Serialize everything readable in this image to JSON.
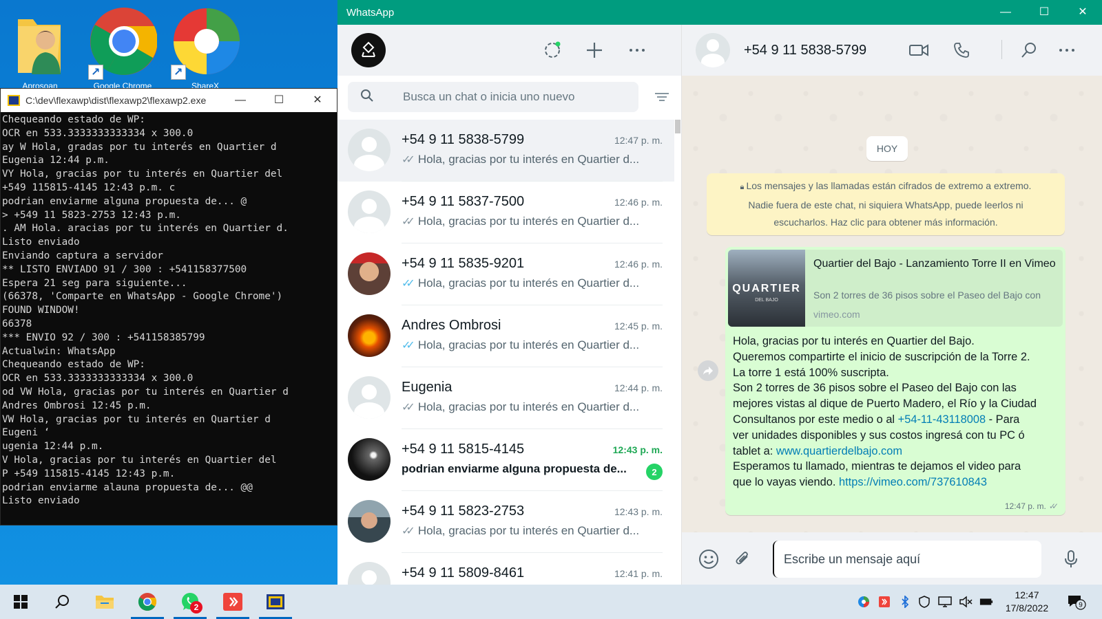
{
  "desktop": {
    "icons": [
      {
        "label": "Aprosoan"
      },
      {
        "label": "Google Chrome"
      },
      {
        "label": "ShareX"
      }
    ]
  },
  "console": {
    "title": "C:\\dev\\flexawp\\dist\\flexawp2\\flexawp2.exe",
    "controls": {
      "minimize": "—",
      "maximize": "☐",
      "close": "✕"
    },
    "lines": [
      "Chequeando estado de WP:",
      "OCR en 533.3333333333334 x 300.0",
      "ay W Hola, gradas por tu interés en Quartier d",
      "Eugenia 12:44 p.m.",
      "VY Hola, gracias por tu interés en Quartier del",
      "+549 115815-4145 12:43 p.m. c",
      "podrian enviarme alguna propuesta de... @",
      "> +549 11 5823-2753 12:43 p.m.",
      ". AM Hola. aracias por tu interés en Quartier d.",
      "Listo enviado",
      "Enviando captura a servidor",
      "** LISTO ENVIADO 91 / 300 : +541158377500",
      "Espera 21 seg para siguiente...",
      "(66378, 'Comparte en WhatsApp - Google Chrome')",
      "FOUND WINDOW!",
      "66378",
      "*** ENVIO 92 / 300 : +541158385799",
      "Actualwin: WhatsApp",
      "Chequeando estado de WP:",
      "OCR en 533.3333333333334 x 300.0",
      "od VW Hola, gracias por tu interés en Quartier d",
      "Andres Ombrosi 12:45 p.m.",
      "VW Hola, gracias por tu interés en Quartier d",
      "Eugeni ‘",
      "ugenia 12:44 p.m.",
      "V Hola, gracias por tu interés en Quartier del",
      "P +549 115815-4145 12:43 p.m.",
      "podrian enviarme alauna propuesta de... @@",
      "Listo enviado"
    ]
  },
  "whatsapp": {
    "window_title": "WhatsApp",
    "window_controls": {
      "minimize": "—",
      "maximize": "☐",
      "close": "✕"
    },
    "accent": "#009c7f",
    "search_placeholder": "Busca un chat o inicia uno nuevo",
    "chats": [
      {
        "name": "+54 9 11 5838-5799",
        "time": "12:47 p. m.",
        "preview": "Hola, gracias por tu interés en Quartier d...",
        "ticks": "read-grey",
        "selected": true
      },
      {
        "name": "+54 9 11 5837-7500",
        "time": "12:46 p. m.",
        "preview": "Hola, gracias por tu interés en Quartier d...",
        "ticks": "grey"
      },
      {
        "name": "+54 9 11 5835-9201",
        "time": "12:46 p. m.",
        "preview": "Hola, gracias por tu interés en Quartier d...",
        "ticks": "blue"
      },
      {
        "name": "Andres Ombrosi",
        "time": "12:45 p. m.",
        "preview": "Hola, gracias por tu interés en Quartier d...",
        "ticks": "blue"
      },
      {
        "name": "Eugenia",
        "time": "12:44 p. m.",
        "preview": "Hola, gracias por tu interés en Quartier d...",
        "ticks": "grey"
      },
      {
        "name": "+54 9 11 5815-4145",
        "time": "12:43 p. m.",
        "preview": "podrian enviarme alguna propuesta de...",
        "unread": "2"
      },
      {
        "name": "+54 9 11 5823-2753",
        "time": "12:43 p. m.",
        "preview": "Hola, gracias por tu interés en Quartier d...",
        "ticks": "grey"
      },
      {
        "name": "+54 9 11 5809-8461",
        "time": "12:41 p. m.",
        "preview": ""
      }
    ],
    "conversation": {
      "contact_name": "+54 9 11 5838-5799",
      "day_label": "HOY",
      "encryption_note": [
        "Los mensajes y las llamadas están cifrados de extremo a extremo.",
        "Nadie fuera de este chat, ni siquiera WhatsApp, puede leerlos ni",
        "escucharlos. Haz clic para obtener más información."
      ],
      "link_preview": {
        "thumb_text": "QUARTIER",
        "thumb_sub": "DEL BAJO",
        "title": "Quartier del Bajo - Lanzamiento Torre II en Vimeo",
        "description": "Son 2 torres de 36 pisos sobre el Paseo del Bajo con",
        "domain": "vimeo.com"
      },
      "message_lines": [
        {
          "text": "Hola, gracias por tu interés en Quartier del Bajo."
        },
        {
          "text": "Queremos compartirte el inicio de suscripción de la Torre 2."
        },
        {
          "text": "La torre 1 está 100% suscripta."
        },
        {
          "text": "Son 2 torres de 36 pisos sobre el Paseo del Bajo con las"
        },
        {
          "text": "mejores vistas al dique de Puerto Madero, el Río y la Ciudad"
        },
        {
          "text": "Consultanos por este medio o al ",
          "link": "+54-11-43118008",
          "after": " - Para"
        },
        {
          "text": "ver unidades disponibles y sus costos ingresá con tu PC ó"
        },
        {
          "text": "tablet a: ",
          "link": "www.quartierdelbajo.com",
          "after": ""
        },
        {
          "text": "Esperamos tu llamado, mientras te dejamos el video para"
        },
        {
          "text": "que lo vayas viendo. ",
          "link": "https://vimeo.com/737610843",
          "after": ""
        }
      ],
      "message_time": "12:47 p. m.",
      "composer_placeholder": "Escribe un mensaje aquí"
    }
  },
  "taskbar": {
    "whatsapp_badge": "2",
    "clock_time": "12:47",
    "clock_date": "17/8/2022",
    "notification_count": "9"
  }
}
